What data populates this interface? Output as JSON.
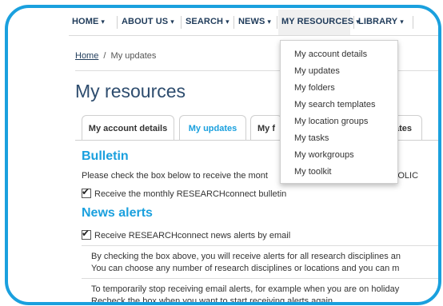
{
  "nav": {
    "items": [
      {
        "label": "HOME",
        "caret": "▾"
      },
      {
        "label": "ABOUT US",
        "caret": "▾"
      },
      {
        "label": "SEARCH",
        "caret": "▾"
      },
      {
        "label": "NEWS",
        "caret": "▾"
      },
      {
        "label": "MY RESOURCES",
        "caret": "▾"
      },
      {
        "label": "LIBRARY",
        "caret": "▾"
      }
    ],
    "active": "MY RESOURCES"
  },
  "breadcrumb": {
    "home": "Home",
    "separator": "/",
    "current": "My updates"
  },
  "page_title": "My resources",
  "tabs": [
    {
      "label": "My account details"
    },
    {
      "label": "My updates"
    },
    {
      "label": "My f"
    },
    {
      "label": "ates"
    }
  ],
  "bulletin": {
    "heading": "Bulletin",
    "intro": "Please check the box below to receive the mont",
    "intro_tail": "POLIC",
    "checkbox_label": "Receive the monthly RESEARCHconnect bulletin",
    "checked": true
  },
  "news_alerts": {
    "heading": "News alerts",
    "checkbox_label": "Receive RESEARCHconnect news alerts by email",
    "checked": true,
    "para1_line1": "By checking the box above, you will receive alerts for all research disciplines an",
    "para1_line2": "You can choose any number of research disciplines or locations and you can m",
    "para2_line1": "To temporarily stop receiving email alerts, for example when you are on holiday",
    "para2_line2": "Recheck the box when you want to start receiving alerts again."
  },
  "dropdown": {
    "items": [
      {
        "label": "My account details"
      },
      {
        "label": "My updates"
      },
      {
        "label": "My folders"
      },
      {
        "label": "My search templates"
      },
      {
        "label": "My location groups"
      },
      {
        "label": "My tasks"
      },
      {
        "label": "My workgroups"
      },
      {
        "label": "My toolkit"
      }
    ]
  },
  "colors": {
    "frame": "#1aa0de",
    "accent": "#1aa0de",
    "nav_text": "#1f3b5a",
    "title": "#2d4c6e"
  }
}
